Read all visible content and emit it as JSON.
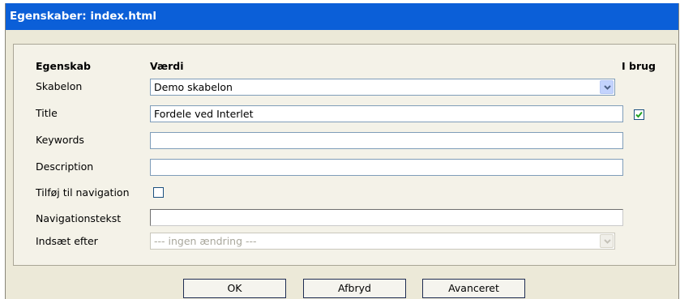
{
  "window": {
    "title": "Egenskaber: index.html"
  },
  "headers": {
    "property": "Egenskab",
    "value": "Værdi",
    "in_use": "I brug"
  },
  "fields": {
    "template": {
      "label": "Skabelon",
      "value": "Demo skabelon"
    },
    "title": {
      "label": "Title",
      "value": "Fordele ved Interlet",
      "in_use": true
    },
    "keywords": {
      "label": "Keywords",
      "value": ""
    },
    "description": {
      "label": "Description",
      "value": ""
    },
    "add_to_nav": {
      "label": "Tilføj til navigation",
      "checked": false
    },
    "nav_text": {
      "label": "Navigationstekst",
      "value": ""
    },
    "insert_after": {
      "label": "Indsæt efter",
      "value": "--- ingen ændring ---",
      "disabled": true
    }
  },
  "buttons": {
    "ok": "OK",
    "cancel": "Afbryd",
    "advanced": "Avanceret"
  },
  "colors": {
    "titlebar": "#0b5fd8",
    "dialog_bg": "#ece9d8",
    "field_border": "#7f9db9",
    "check": "#21a121"
  }
}
